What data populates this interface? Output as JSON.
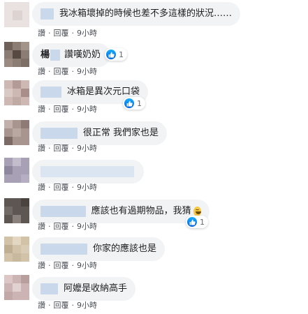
{
  "actions": {
    "like": "讚",
    "dot": "·",
    "reply": "回覆",
    "time": "9小時"
  },
  "comments": [
    {
      "text": "我冰箱壞掉的時候也差不多這樣的狀況……",
      "reaction": ""
    },
    {
      "name_visible": "楊",
      "text": "讚嘆奶奶",
      "reaction": "1"
    },
    {
      "text": "冰箱是異次元口袋",
      "reaction": "1"
    },
    {
      "text": "很正常 我們家也是",
      "reaction": ""
    },
    {
      "text": "",
      "reaction": ""
    },
    {
      "text": "應該也有過期物品，我猜",
      "emoji": "grinning-face",
      "reaction": "1"
    },
    {
      "text": "你家的應該也是",
      "reaction": ""
    },
    {
      "text": "阿嬤是收納高手",
      "reaction": ""
    }
  ],
  "colors": {
    "bubble": "#f2f3f5",
    "like_blue": "#1877f2",
    "blur": "#c9d8ea"
  }
}
